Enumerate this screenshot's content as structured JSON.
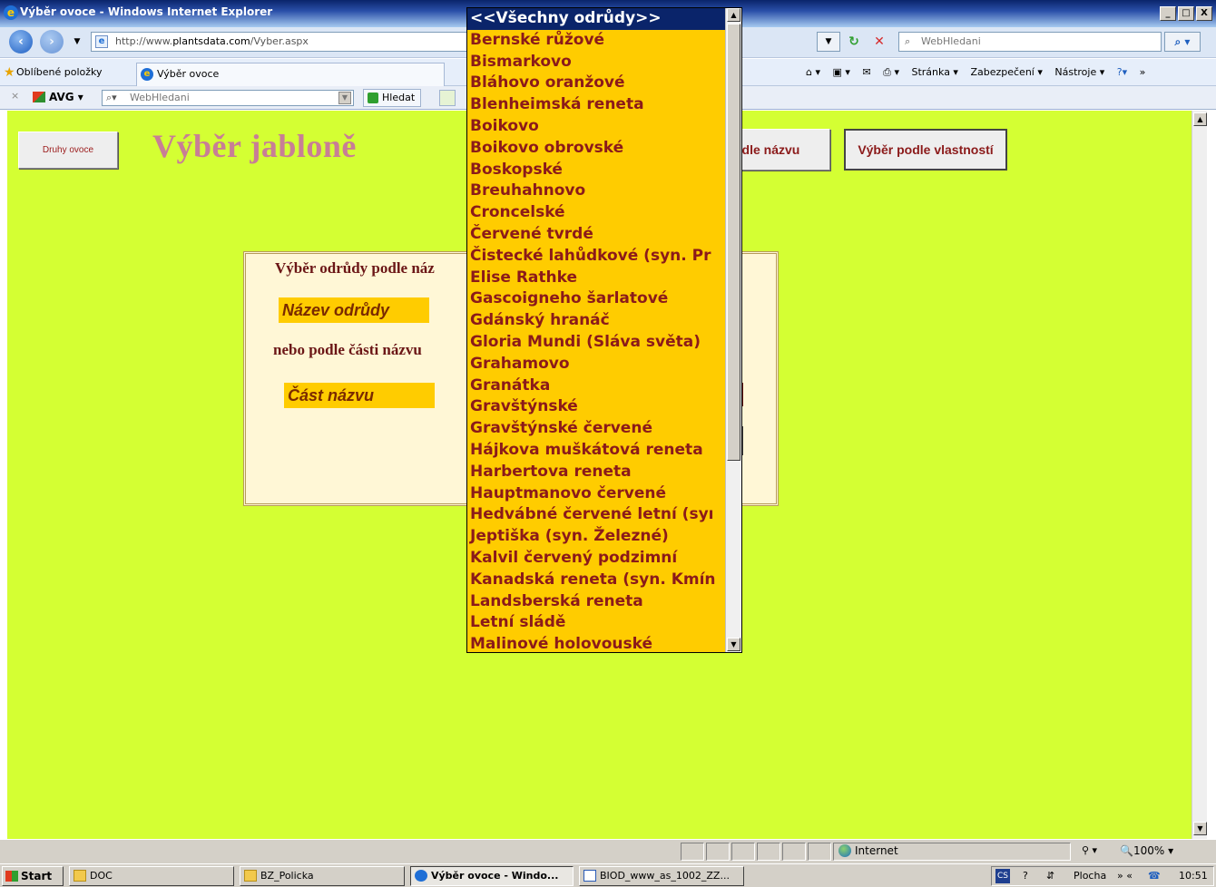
{
  "window": {
    "title": "Výběr ovoce - Windows Internet Explorer",
    "controls": [
      "_",
      "□",
      "X"
    ]
  },
  "browser": {
    "url_prefix": "http://www.",
    "url_host": "plantsdata.com",
    "url_path": "/Vyber.aspx",
    "search_placeholder": "WebHledani",
    "favorites_label": "Oblíbené položky",
    "tab_title": "Výběr ovoce",
    "commands": [
      "Stránka ▾",
      "Zabezpečení ▾",
      "Nástroje ▾"
    ],
    "avg_label": "AVG",
    "avg_search_placeholder": "WebHledani",
    "avg_search_button": "Hledat"
  },
  "page": {
    "nav_button_label": "Druhy ovoce",
    "heading": "Výběr jabloně",
    "by_name_button_label": "odle názvu",
    "by_properties_button_label": "Výběr podle vlastností",
    "panel_title": "Výběr odrůdy podle náz",
    "variety_name_field": "Název odrůdy",
    "or_text": "nebo podle části názvu",
    "name_part_field": "Část názvu"
  },
  "dropdown": {
    "selected": "<<Všechny odrůdy>>",
    "items": [
      "Bernské růžové",
      "Bismarkovo",
      "Bláhovo oranžové",
      "Blenheimská reneta",
      "Boikovo",
      "Boikovo obrovské",
      "Boskopské",
      "Breuhahnovo",
      "Croncelské",
      "Červené tvrdé",
      "Čistecké lahůdkové (syn. Pr",
      "Elise Rathke",
      "Gascoigneho šarlatové",
      "Gdánský hranáč",
      "Gloria Mundi (Sláva světa)",
      "Grahamovo",
      "Granátka",
      "Gravštýnské",
      "Gravštýnské červené",
      "Hájkova muškátová reneta",
      "Harbertova reneta",
      "Hauptmanovo červené",
      "Hedvábné červené letní (syı",
      "Jeptiška (syn. Železné)",
      "Kalvil červený podzimní",
      "Kanadská reneta (syn. Kmín",
      "Landsberská reneta",
      "Letní sládě",
      "Malinové holovouské"
    ]
  },
  "statusbar": {
    "zone": "Internet",
    "zoom": "100%"
  },
  "taskbar": {
    "start": "Start",
    "tasks": [
      "DOC",
      "BZ_Policka",
      "Výběr ovoce - Windo...",
      "BIOD_www_as_1002_ZZ..."
    ],
    "tray_desktop": "Plocha",
    "clock": "10:51"
  },
  "colors": {
    "page_background": "#d4ff33",
    "dropdown_background": "#ffcc00",
    "text_maroon": "#8b1a1a",
    "heading_pink": "#c87e96",
    "selection": "#0a246a"
  }
}
